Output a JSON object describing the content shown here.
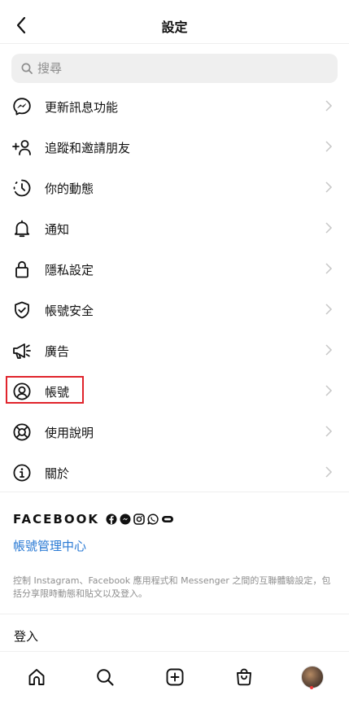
{
  "header": {
    "title": "設定"
  },
  "search": {
    "placeholder": "搜尋"
  },
  "menu": [
    {
      "label": "更新訊息功能",
      "icon": "messenger-icon"
    },
    {
      "label": "追蹤和邀請朋友",
      "icon": "add-person-icon"
    },
    {
      "label": "你的動態",
      "icon": "activity-icon"
    },
    {
      "label": "通知",
      "icon": "bell-icon"
    },
    {
      "label": "隱私設定",
      "icon": "lock-icon"
    },
    {
      "label": "帳號安全",
      "icon": "shield-check-icon"
    },
    {
      "label": "廣告",
      "icon": "megaphone-icon"
    },
    {
      "label": "帳號",
      "icon": "account-circle-icon"
    },
    {
      "label": "使用說明",
      "icon": "lifebuoy-icon"
    },
    {
      "label": "關於",
      "icon": "info-icon"
    }
  ],
  "facebook": {
    "brand": "FACEBOOK",
    "accounts_center": "帳號管理中心",
    "description": "控制 Instagram、Facebook 應用程式和 Messenger 之間的互聯體驗設定，包括分享限時動態和貼文以及登入。"
  },
  "login": {
    "label": "登入"
  },
  "colors": {
    "accent": "#2a7ad4",
    "highlight_border": "#e0242c",
    "notification_dot": "#ee3a3a"
  }
}
